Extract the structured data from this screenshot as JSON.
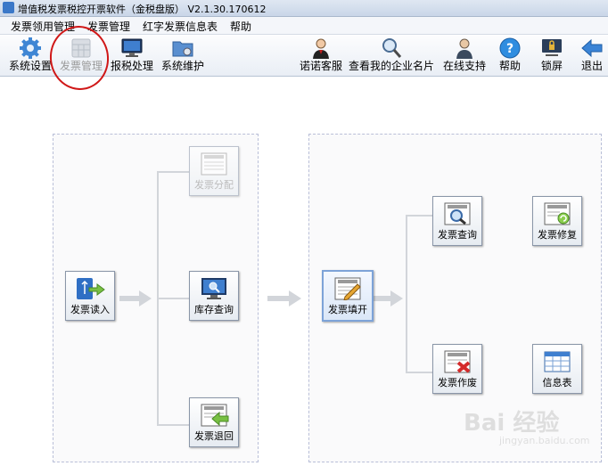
{
  "window": {
    "title": "增值税发票税控开票软件（金税盘版） V2.1.30.170612"
  },
  "menu": [
    {
      "label": "发票领用管理"
    },
    {
      "label": "发票管理"
    },
    {
      "label": "红字发票信息表"
    },
    {
      "label": "帮助"
    }
  ],
  "toolbar": {
    "left": [
      {
        "label": "系统设置",
        "icon": "gear-icon"
      },
      {
        "label": "发票管理",
        "icon": "invoice-grid-icon",
        "state": "disabled-highlighted"
      },
      {
        "label": "报税处理",
        "icon": "monitor-icon"
      },
      {
        "label": "系统维护",
        "icon": "folder-gear-icon"
      }
    ],
    "right": [
      {
        "label": "诺诺客服",
        "icon": "agent-icon"
      },
      {
        "label": "查看我的企业名片",
        "icon": "magnifier-icon"
      },
      {
        "label": "在线支持",
        "icon": "support-person-icon"
      },
      {
        "label": "帮助",
        "icon": "help-icon"
      },
      {
        "label": "锁屏",
        "icon": "lock-screen-icon"
      },
      {
        "label": "退出",
        "icon": "exit-arrow-icon"
      }
    ]
  },
  "flow": {
    "left_panel": {
      "source": {
        "label": "发票读入",
        "icon": "usb-import-icon"
      },
      "targets": [
        {
          "label": "发票分配",
          "icon": "invoice-distribute-icon",
          "state": "disabled"
        },
        {
          "label": "库存查询",
          "icon": "monitor-search-icon"
        },
        {
          "label": "发票退回",
          "icon": "invoice-return-icon"
        }
      ]
    },
    "right_panel": {
      "source": {
        "label": "发票填开",
        "icon": "invoice-write-icon"
      },
      "targets": [
        {
          "label": "发票查询",
          "icon": "invoice-search-icon"
        },
        {
          "label": "发票修复",
          "icon": "invoice-repair-icon"
        },
        {
          "label": "发票作废",
          "icon": "invoice-void-icon"
        },
        {
          "label": "信息表",
          "icon": "table-icon"
        }
      ]
    }
  },
  "watermark": {
    "line1": "Bai 经验",
    "line2": "jingyan.baidu.com"
  },
  "colors": {
    "accent": "#3b78c8",
    "annotation_circle": "#d01818",
    "void_mark": "#d42a2a",
    "arrow_grey": "#d2d5da"
  }
}
